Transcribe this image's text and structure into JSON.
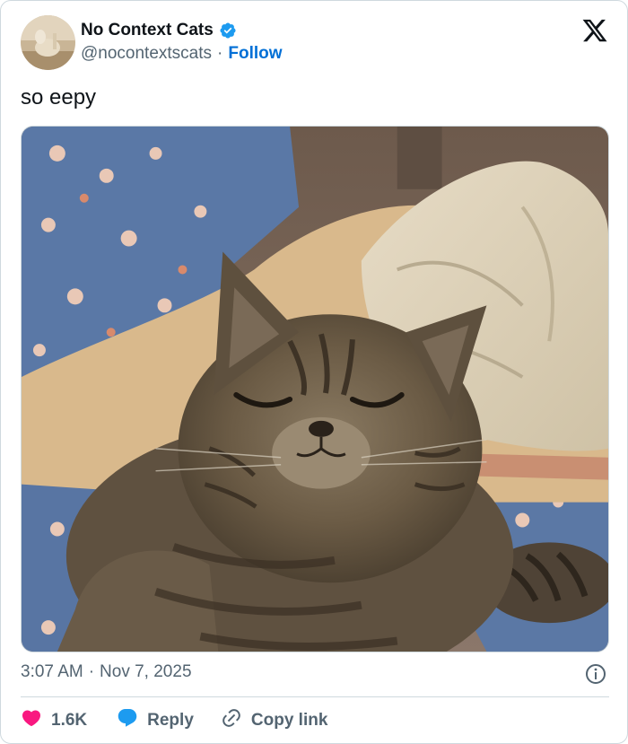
{
  "author": {
    "display_name": "No Context Cats",
    "handle": "@nocontextscats",
    "separator": "·",
    "follow_label": "Follow",
    "verified": true,
    "verified_color": "#1d9bf0"
  },
  "tweet": {
    "text": "so eepy",
    "media_description": "photo of a sleepy tabby cat"
  },
  "meta": {
    "time": "3:07 AM",
    "separator": "·",
    "date": "Nov 7, 2025"
  },
  "actions": {
    "likes_count": "1.6K",
    "reply_label": "Reply",
    "copy_link_label": "Copy link"
  },
  "colors": {
    "like": "#f91880",
    "reply": "#1d9bf0",
    "link": "#006fd6",
    "muted": "#536471",
    "text": "#0f1419"
  },
  "icons": {
    "brand": "x-logo-icon",
    "verified": "verified-badge-icon",
    "info": "info-icon",
    "like": "heart-icon",
    "reply": "speech-bubble-icon",
    "copy": "link-icon"
  }
}
